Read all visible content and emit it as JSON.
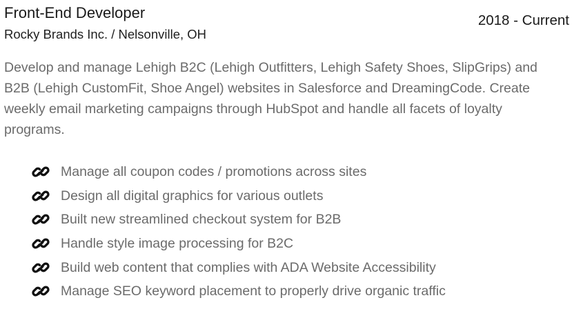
{
  "entry": {
    "title": "Front-End Developer",
    "company": "Rocky Brands Inc. / Nelsonville, OH",
    "dates": "2018 - Current",
    "summary": "Develop and manage Lehigh B2C (Lehigh Outfitters, Lehigh Safety Shoes, SlipGrips) and B2B (Lehigh CustomFit, Shoe Angel) websites in Salesforce and DreamingCode. Create weekly email marketing campaigns through HubSpot and handle all facets of loyalty programs.",
    "bullet_icon": "link-icon",
    "bullets": [
      "Manage all coupon codes / promotions across sites",
      "Design all digital graphics for various outlets",
      "Built new streamlined checkout system for B2B",
      "Handle style image processing for B2C",
      "Build web content that complies with ADA Website Accessibility",
      "Manage SEO keyword placement to properly drive organic traffic"
    ]
  },
  "colors": {
    "heading": "#1a1a1a",
    "body_text": "#6b6b6b",
    "icon": "#111111"
  }
}
